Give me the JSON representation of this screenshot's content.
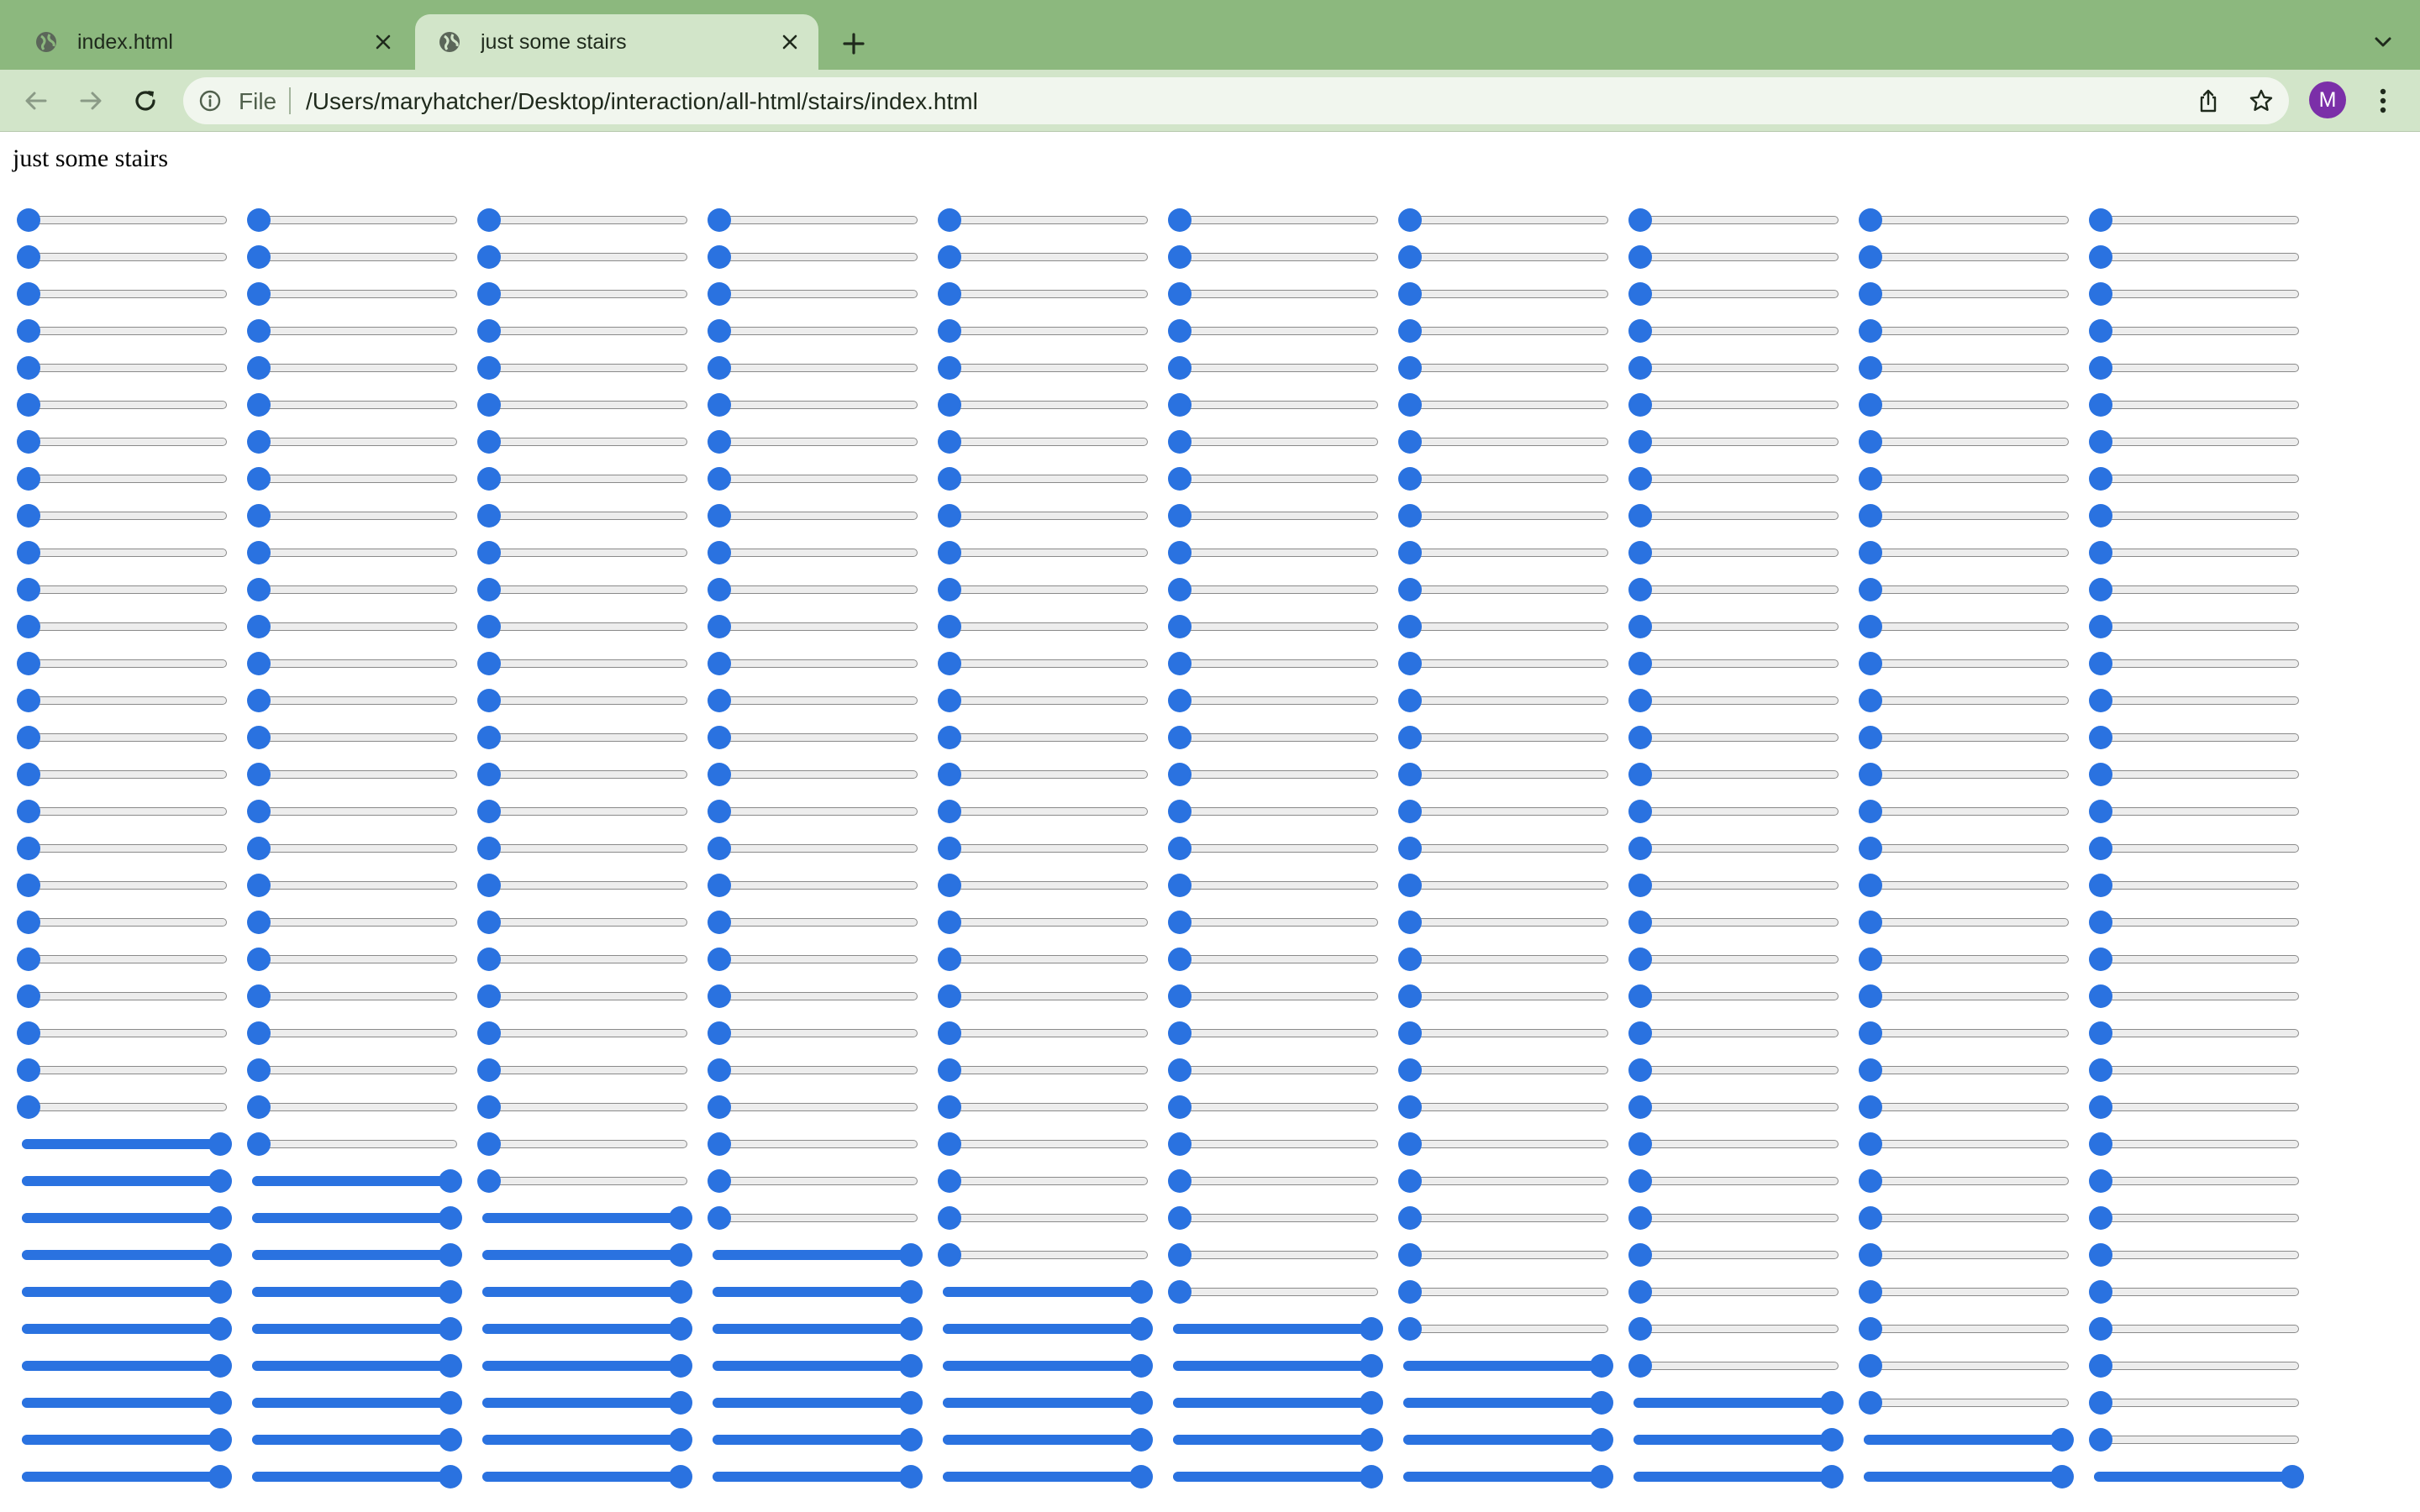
{
  "browser": {
    "tabs": [
      {
        "title": "index.html",
        "active": false
      },
      {
        "title": "just some stairs",
        "active": true
      }
    ],
    "omnibox": {
      "scheme_chip": "File",
      "url": "/Users/maryhatcher/Desktop/interaction/all-html/stairs/index.html"
    },
    "profile_initial": "M"
  },
  "page": {
    "heading": "just some stairs",
    "sliders": {
      "columns": 10,
      "rows": 35,
      "min": 0,
      "max": 1,
      "values_by_column": [
        [
          0,
          0,
          0,
          0,
          0,
          0,
          0,
          0,
          0,
          0,
          0,
          0,
          0,
          0,
          0,
          0,
          0,
          0,
          0,
          0,
          0,
          0,
          0,
          0,
          0,
          1,
          1,
          1,
          1,
          1,
          1,
          1,
          1,
          1,
          1
        ],
        [
          0,
          0,
          0,
          0,
          0,
          0,
          0,
          0,
          0,
          0,
          0,
          0,
          0,
          0,
          0,
          0,
          0,
          0,
          0,
          0,
          0,
          0,
          0,
          0,
          0,
          0,
          1,
          1,
          1,
          1,
          1,
          1,
          1,
          1,
          1
        ],
        [
          0,
          0,
          0,
          0,
          0,
          0,
          0,
          0,
          0,
          0,
          0,
          0,
          0,
          0,
          0,
          0,
          0,
          0,
          0,
          0,
          0,
          0,
          0,
          0,
          0,
          0,
          0,
          1,
          1,
          1,
          1,
          1,
          1,
          1,
          1
        ],
        [
          0,
          0,
          0,
          0,
          0,
          0,
          0,
          0,
          0,
          0,
          0,
          0,
          0,
          0,
          0,
          0,
          0,
          0,
          0,
          0,
          0,
          0,
          0,
          0,
          0,
          0,
          0,
          0,
          1,
          1,
          1,
          1,
          1,
          1,
          1
        ],
        [
          0,
          0,
          0,
          0,
          0,
          0,
          0,
          0,
          0,
          0,
          0,
          0,
          0,
          0,
          0,
          0,
          0,
          0,
          0,
          0,
          0,
          0,
          0,
          0,
          0,
          0,
          0,
          0,
          0,
          1,
          1,
          1,
          1,
          1,
          1
        ],
        [
          0,
          0,
          0,
          0,
          0,
          0,
          0,
          0,
          0,
          0,
          0,
          0,
          0,
          0,
          0,
          0,
          0,
          0,
          0,
          0,
          0,
          0,
          0,
          0,
          0,
          0,
          0,
          0,
          0,
          0,
          1,
          1,
          1,
          1,
          1
        ],
        [
          0,
          0,
          0,
          0,
          0,
          0,
          0,
          0,
          0,
          0,
          0,
          0,
          0,
          0,
          0,
          0,
          0,
          0,
          0,
          0,
          0,
          0,
          0,
          0,
          0,
          0,
          0,
          0,
          0,
          0,
          0,
          1,
          1,
          1,
          1
        ],
        [
          0,
          0,
          0,
          0,
          0,
          0,
          0,
          0,
          0,
          0,
          0,
          0,
          0,
          0,
          0,
          0,
          0,
          0,
          0,
          0,
          0,
          0,
          0,
          0,
          0,
          0,
          0,
          0,
          0,
          0,
          0,
          0,
          1,
          1,
          1
        ],
        [
          0,
          0,
          0,
          0,
          0,
          0,
          0,
          0,
          0,
          0,
          0,
          0,
          0,
          0,
          0,
          0,
          0,
          0,
          0,
          0,
          0,
          0,
          0,
          0,
          0,
          0,
          0,
          0,
          0,
          0,
          0,
          0,
          0,
          1,
          1
        ],
        [
          0,
          0,
          0,
          0,
          0,
          0,
          0,
          0,
          0,
          0,
          0,
          0,
          0,
          0,
          0,
          0,
          0,
          0,
          0,
          0,
          0,
          0,
          0,
          0,
          0,
          0,
          0,
          0,
          0,
          0,
          0,
          0,
          0,
          0,
          1
        ]
      ]
    }
  },
  "colors": {
    "frame": "#8cb87e",
    "toolbar": "#d2e5c9",
    "slider_accent": "#2a72e0",
    "slider_track": "#ededed",
    "avatar": "#7b2fa8"
  }
}
